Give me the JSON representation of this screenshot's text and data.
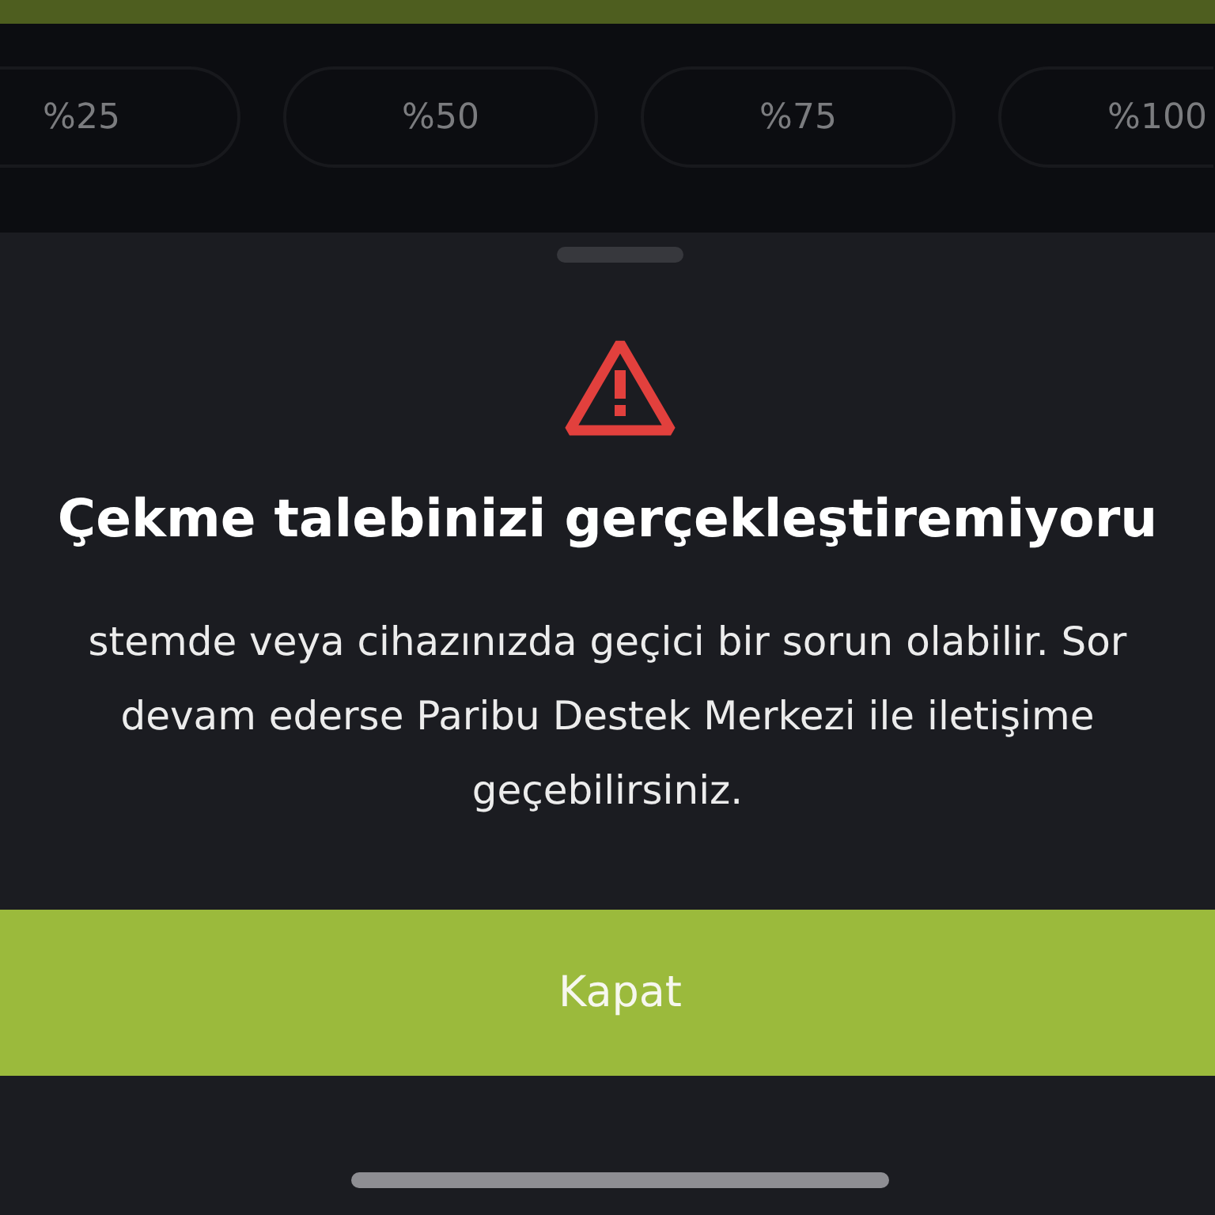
{
  "percent_options": [
    {
      "label": "%25"
    },
    {
      "label": "%50"
    },
    {
      "label": "%75"
    },
    {
      "label": "%100"
    }
  ],
  "sheet": {
    "title": "Çekme talebinizi gerçekleştiremiyoru",
    "message_lines": [
      "stemde veya cihazınızda geçici bir sorun olabilir. Sor",
      "devam ederse Paribu Destek Merkezi ile iletişime",
      "geçebilirsiniz."
    ],
    "button": {
      "label": "Kapat"
    }
  }
}
